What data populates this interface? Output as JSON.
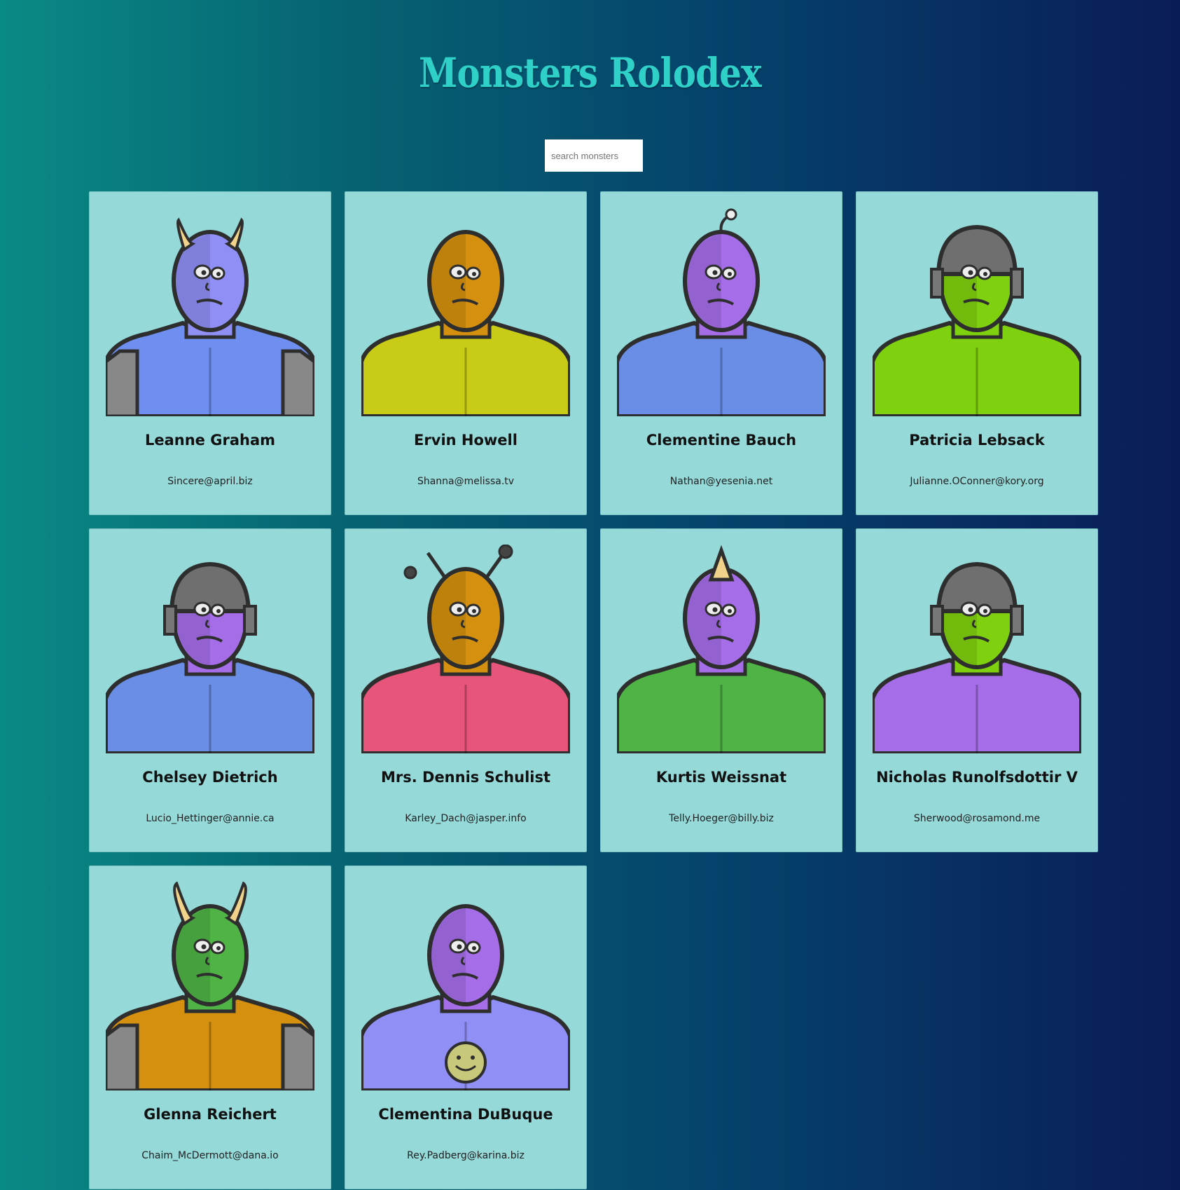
{
  "header": {
    "title": "Monsters Rolodex"
  },
  "search": {
    "placeholder": "search monsters",
    "value": ""
  },
  "monsters": [
    {
      "name": "Leanne Graham",
      "email": "Sincere@april.biz",
      "head_color": "#8f8ff5",
      "body_color": "#6e8ff0",
      "accent": "horns-small"
    },
    {
      "name": "Ervin Howell",
      "email": "Shanna@melissa.tv",
      "head_color": "#d4900e",
      "body_color": "#c9cc16",
      "accent": "hood"
    },
    {
      "name": "Clementine Bauch",
      "email": "Nathan@yesenia.net",
      "head_color": "#a56ee8",
      "body_color": "#6a8ee6",
      "accent": "antenna"
    },
    {
      "name": "Patricia Lebsack",
      "email": "Julianne.OConner@kory.org",
      "head_color": "#7fd10f",
      "body_color": "#7fd10f",
      "accent": "helmet"
    },
    {
      "name": "Chelsey Dietrich",
      "email": "Lucio_Hettinger@annie.ca",
      "head_color": "#a56ee8",
      "body_color": "#6a8ee6",
      "accent": "helmet"
    },
    {
      "name": "Mrs. Dennis Schulist",
      "email": "Karley_Dach@jasper.info",
      "head_color": "#d4900e",
      "body_color": "#e8557a",
      "accent": "antennae"
    },
    {
      "name": "Kurtis Weissnat",
      "email": "Telly.Hoeger@billy.biz",
      "head_color": "#a56ee8",
      "body_color": "#4fb346",
      "accent": "horn"
    },
    {
      "name": "Nicholas Runolfsdottir V",
      "email": "Sherwood@rosamond.me",
      "head_color": "#7fd10f",
      "body_color": "#a56ee8",
      "accent": "helmet"
    },
    {
      "name": "Glenna Reichert",
      "email": "Chaim_McDermott@dana.io",
      "head_color": "#4fb346",
      "body_color": "#d4900e",
      "accent": "horns-big"
    },
    {
      "name": "Clementina DuBuque",
      "email": "Rey.Padberg@karina.biz",
      "head_color": "#a56ee8",
      "body_color": "#8f8ff5",
      "accent": "smiley"
    }
  ]
}
